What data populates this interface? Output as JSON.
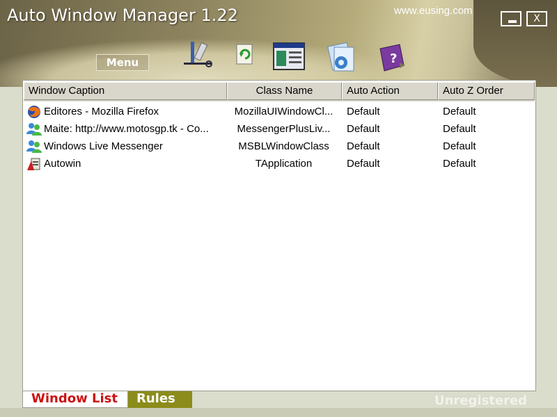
{
  "app": {
    "title": "Auto Window Manager 1.22",
    "website": "www.eusing.com",
    "minimize_label": "",
    "close_label": "X",
    "menu_label": "Menu"
  },
  "toolbar": {
    "tools": [
      {
        "icon": "pen-ruler-icon"
      },
      {
        "icon": "refresh-page-icon"
      },
      {
        "icon": "window-settings-icon"
      },
      {
        "icon": "gear-documents-icon"
      },
      {
        "icon": "help-book-icon"
      }
    ]
  },
  "table": {
    "columns": [
      "Window Caption",
      "Class Name",
      "Auto Action",
      "Auto Z Order"
    ],
    "rows": [
      {
        "icon": "firefox-icon",
        "caption": "Editores - Mozilla Firefox",
        "class_name": "MozillaUIWindowCl...",
        "action": "Default",
        "zorder": "Default"
      },
      {
        "icon": "messenger-users-icon",
        "caption": "Maite: http://www.motosgp.tk - Co...",
        "class_name": "MessengerPlusLiv...",
        "action": "Default",
        "zorder": "Default"
      },
      {
        "icon": "messenger-users-icon",
        "caption": "Windows Live Messenger",
        "class_name": "MSBLWindowClass",
        "action": "Default",
        "zorder": "Default"
      },
      {
        "icon": "autowin-app-icon",
        "caption": "Autowin",
        "class_name": "TApplication",
        "action": "Default",
        "zorder": "Default"
      }
    ]
  },
  "tabs": {
    "window_list": "Window List",
    "rules": "Rules"
  },
  "status": {
    "registration": "Unregistered"
  },
  "colors": {
    "active_tab_text": "#cc1111",
    "inactive_tab_bg": "#8c8c1c",
    "panel_bg": "#ffffff"
  }
}
